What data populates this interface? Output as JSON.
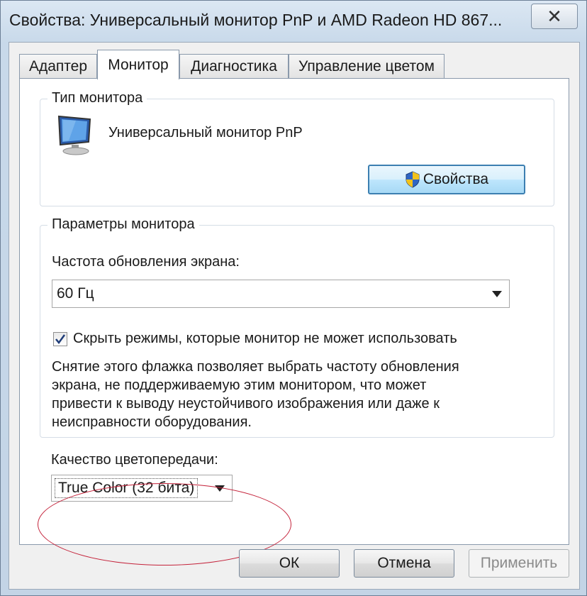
{
  "window": {
    "title": "Свойства: Универсальный монитор PnP и AMD Radeon HD 867...",
    "close_symbol": "✕"
  },
  "tabs": [
    {
      "label": "Адаптер",
      "active": false
    },
    {
      "label": "Монитор",
      "active": true
    },
    {
      "label": "Диагностика",
      "active": false
    },
    {
      "label": "Управление цветом",
      "active": false
    }
  ],
  "monitor_type": {
    "group_title": "Тип монитора",
    "icon": "monitor-icon",
    "monitor_name": "Универсальный монитор PnP",
    "properties_button": "Свойства",
    "properties_icon": "uac-shield-icon"
  },
  "monitor_params": {
    "group_title": "Параметры монитора",
    "refresh_label": "Частота обновления экрана:",
    "refresh_value": "60 Гц",
    "hide_modes_checked": true,
    "hide_modes_label": "Скрыть режимы, которые монитор не может использовать",
    "description_lines": [
      "Снятие этого флажка позволяет выбрать частоту обновления",
      "экрана, не поддерживаемую этим монитором, что может",
      "привести к выводу неустойчивого изображения или даже к",
      "неисправности оборудования."
    ]
  },
  "color_quality": {
    "label": "Качество цветопередачи:",
    "value": "True Color (32 бита)"
  },
  "footer": {
    "ok": "ОК",
    "cancel": "Отмена",
    "apply": "Применить"
  },
  "colors": {
    "highlight_ellipse": "#c4223a",
    "focus_button": "#3c7fb1"
  }
}
